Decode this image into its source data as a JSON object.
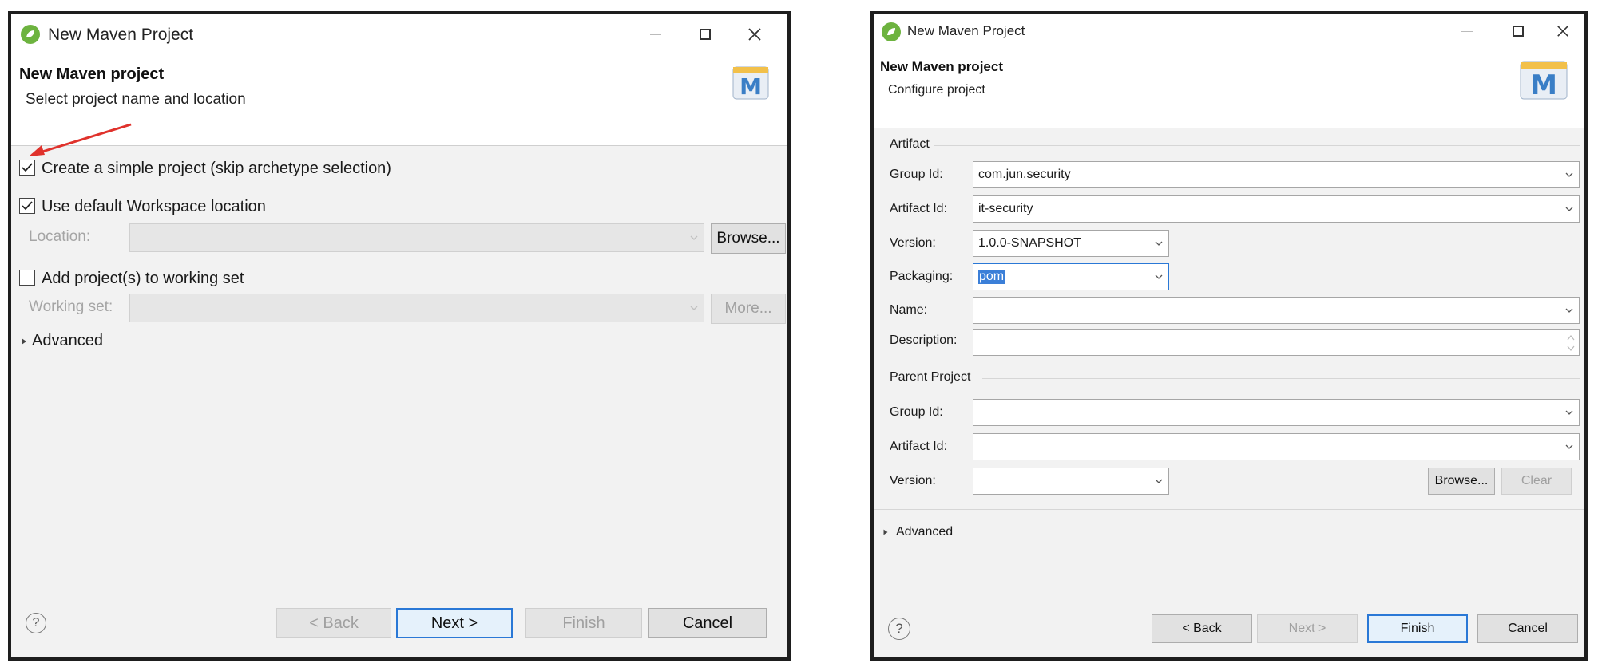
{
  "dialog1": {
    "window_title": "New Maven Project",
    "header_title": "New Maven project",
    "header_subtitle": "Select project name and location",
    "simple_project_label": "Create a simple project (skip archetype selection)",
    "simple_project_checked": true,
    "default_workspace_label": "Use default Workspace location",
    "default_workspace_checked": true,
    "location_label": "Location:",
    "location_value": "",
    "browse_button": "Browse...",
    "working_set_check_label": "Add project(s) to working set",
    "working_set_checked": false,
    "working_set_label": "Working set:",
    "working_set_value": "",
    "more_button": "More...",
    "advanced_label": "Advanced",
    "help_glyph": "?",
    "back_button": "< Back",
    "next_button": "Next >",
    "finish_button": "Finish",
    "cancel_button": "Cancel"
  },
  "dialog2": {
    "window_title": "New Maven Project",
    "header_title": "New Maven project",
    "header_subtitle": "Configure project",
    "artifact_group_label": "Artifact",
    "group_id_label": "Group Id:",
    "group_id_value": "com.jun.security",
    "artifact_id_label": "Artifact Id:",
    "artifact_id_value": "it-security",
    "version_label": "Version:",
    "version_value": "1.0.0-SNAPSHOT",
    "packaging_label": "Packaging:",
    "packaging_value": "pom",
    "name_label": "Name:",
    "name_value": "",
    "description_label": "Description:",
    "description_value": "",
    "parent_group_label": "Parent Project",
    "parent_group_id_label": "Group Id:",
    "parent_group_id_value": "",
    "parent_artifact_id_label": "Artifact Id:",
    "parent_artifact_id_value": "",
    "parent_version_label": "Version:",
    "parent_version_value": "",
    "browse_button": "Browse...",
    "clear_button": "Clear",
    "advanced_label": "Advanced",
    "help_glyph": "?",
    "back_button": "< Back",
    "next_button": "Next >",
    "finish_button": "Finish",
    "cancel_button": "Cancel"
  },
  "brand_badge_letter": "M",
  "colors": {
    "accent_default_button": "#2a78d6",
    "selection": "#3b7fd8",
    "spring_green": "#6db33f",
    "annotation_arrow": "#e0322c",
    "maven_badge": "#3a7ec6"
  },
  "icons": [
    "spring-leaf-icon",
    "minimize-icon",
    "maximize-icon",
    "close-icon",
    "maven-m-icon",
    "checkmark-icon",
    "chevron-down-icon",
    "expand-triangle-icon",
    "help-icon",
    "annotation-arrow-icon",
    "spinner-icon"
  ]
}
